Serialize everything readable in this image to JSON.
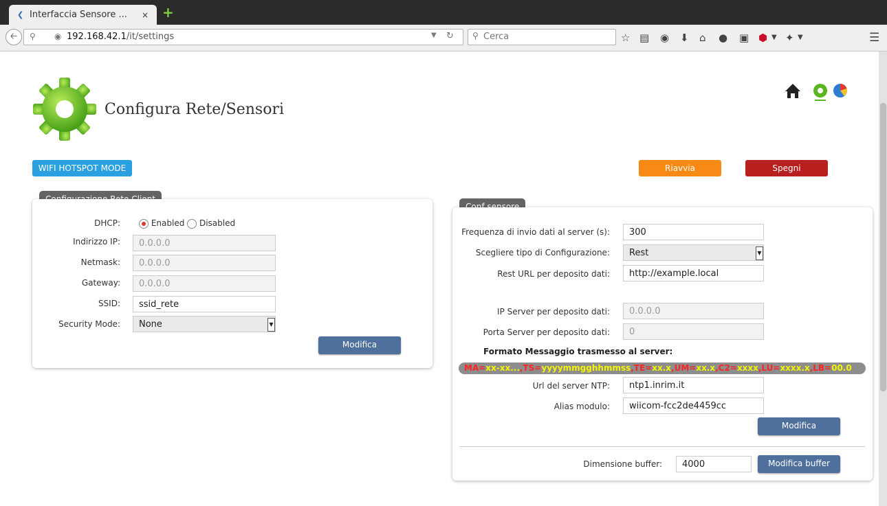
{
  "browser": {
    "tab_title": "Interfaccia Sensore ...",
    "tab_close": "×",
    "url_host": "192.168.42.1",
    "url_path": "/it/settings",
    "search_placeholder": "Cerca"
  },
  "page": {
    "title": "Configura Rete/Sensori"
  },
  "buttons": {
    "hotspot": "WIFI HOTSPOT MODE",
    "riavvia": "Riavvia",
    "spegni": "Spegni"
  },
  "client": {
    "header": "Configurazione Rete Client",
    "dhcp_label": "DHCP:",
    "dhcp_enabled": "Enabled",
    "dhcp_disabled": "Disabled",
    "ip_label": "Indirizzo IP:",
    "ip_value": "0.0.0.0",
    "netmask_label": "Netmask:",
    "netmask_value": "0.0.0.0",
    "gateway_label": "Gateway:",
    "gateway_value": "0.0.0.0",
    "ssid_label": "SSID:",
    "ssid_value": "ssid_rete",
    "security_label": "Security Mode:",
    "security_value": "None",
    "submit": "Modifica"
  },
  "sensor": {
    "header": "Conf sensore",
    "freq_label": "Frequenza di invio dati al server (s):",
    "freq_value": "300",
    "config_type_label": "Scegliere tipo di Configurazione:",
    "config_type_value": "Rest",
    "rest_url_label": "Rest URL per deposito dati:",
    "rest_url_value": "http://example.local",
    "ip_server_label": "IP Server per deposito dati:",
    "ip_server_value": "0.0.0.0",
    "port_server_label": "Porta Server per deposito dati:",
    "port_server_value": "0",
    "format_label": "Formato Messaggio trasmesso al server:",
    "format": {
      "ma_k": "MA=",
      "ma_v": "xx-xx...",
      "ts_k": ",TS=",
      "ts_v": "yyyymmgghhmmss",
      "te_k": ",TE=",
      "te_v": "xx.x",
      "um_k": ",UM=",
      "um_v": "xx.x",
      "c2_k": ",C2=",
      "c2_v": "xxxx",
      "lu_k": ",LU=",
      "lu_v": "xxxx.x",
      "lb_k": ",LB=",
      "lb_v": "00.0"
    },
    "ntp_label": "Url del server NTP:",
    "ntp_value": "ntp1.inrim.it",
    "alias_label": "Alias modulo:",
    "alias_value": "wiicom-fcc2de4459cc",
    "submit": "Modifica",
    "buffer_label": "Dimensione buffer:",
    "buffer_value": "4000",
    "buffer_submit": "Modifica buffer"
  }
}
